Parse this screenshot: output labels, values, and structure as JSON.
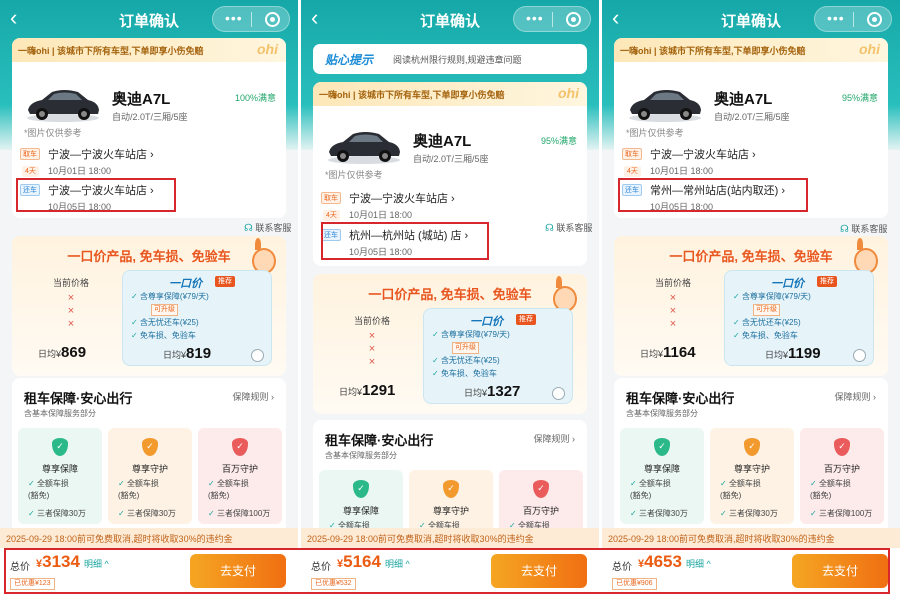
{
  "colors": {
    "header_teal": "#16a8a8",
    "price_orange": "#ec5b12",
    "pay_button": "#f06f12",
    "highlight_red": "#d8262d"
  },
  "icons": {
    "back": "chevron-left-icon",
    "more": "ellipsis-icon",
    "record": "record-icon",
    "service": "headset-icon",
    "check": "check-icon"
  },
  "common": {
    "page_title": "订单确认",
    "back_glyph": "‹",
    "more_glyph": "•••",
    "ohi_banner": "一嗨ohi | 该城市下所有车型,下单即享小伤免赔",
    "ohi_logo": "ohi",
    "tip_title": "贴心提示",
    "tip_text": "阅读杭州限行规则,规避违章问题",
    "car_name": "奥迪A7L",
    "car_spec": "自动/2.0T/三厢/5座",
    "image_ref": "*图片仅供参考",
    "pickup_tag": "取车",
    "return_tag": "还车",
    "days": "4天",
    "service": "联系客服",
    "promo_title": "一口价产品, 免车损、免验车",
    "current_label": "当前价格",
    "cross": "×",
    "daily_prefix": "日均¥",
    "one_price_title": "一口价",
    "recommend": "推荐",
    "upgrade": "可升级",
    "one_items": [
      "含尊享保障(¥79/天)",
      "含无忧还车(¥25)",
      "免车损、免验车"
    ],
    "ins_title": "租车保障·安心出行",
    "ins_sub": "含基本保障服务部分",
    "ins_rules": "保障规则 ›",
    "plans": [
      {
        "name": "尊享保障",
        "lines": [
          "全额车损",
          "(豁免)",
          "三者保障30万"
        ]
      },
      {
        "name": "尊享守护",
        "lines": [
          "全额车损",
          "(豁免)",
          "三者保障30万"
        ]
      },
      {
        "name": "百万守护",
        "lines": [
          "全额车损",
          "(豁免)",
          "三者保障100万"
        ]
      }
    ],
    "notice": "2025-09-29 18:00前可免费取消,超时将收取30%的违约金",
    "total_label": "总价",
    "currency": "¥",
    "detail": "明细 ^",
    "pay_button": "去支付"
  },
  "panels": [
    {
      "satisfaction": "100%满意",
      "pickup_loc": "宁波—宁波火车站店 ›",
      "pickup_time": "10月01日 18:00",
      "return_loc": "宁波—宁波火车站店 ›",
      "return_time": "10月05日 18:00",
      "current_price": "869",
      "one_price": "819",
      "total": "3134",
      "saving": "已优惠¥123"
    },
    {
      "satisfaction": "95%满意",
      "pickup_loc": "宁波—宁波火车站店 ›",
      "pickup_time": "10月01日 18:00",
      "return_loc": "杭州—杭州站 (城站) 店 ›",
      "return_time": "10月05日 18:00",
      "current_price": "1291",
      "one_price": "1327",
      "total": "5164",
      "saving": "已优惠¥532"
    },
    {
      "satisfaction": "95%满意",
      "pickup_loc": "宁波—宁波火车站店 ›",
      "pickup_time": "10月01日 18:00",
      "return_loc": "常州—常州站店(站内取还) ›",
      "return_time": "10月05日 18:00",
      "current_price": "1164",
      "one_price": "1199",
      "total": "4653",
      "saving": "已优惠¥906"
    }
  ]
}
